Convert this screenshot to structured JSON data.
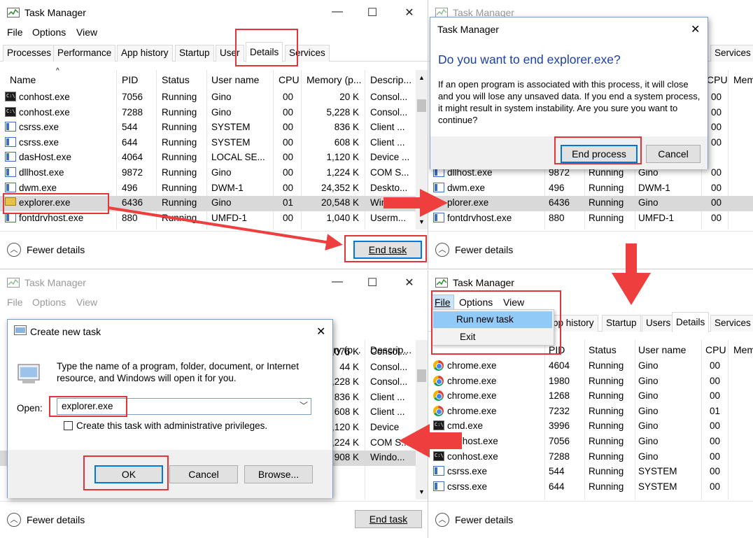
{
  "app": {
    "title": "Task Manager",
    "min": "—",
    "max": "☐",
    "close": "✕"
  },
  "menu": {
    "file": "File",
    "options": "Options",
    "view": "View",
    "run_new_task": "Run new task",
    "exit": "Exit"
  },
  "tabs": {
    "processes": "Processes",
    "performance": "Performance",
    "app_history": "App history",
    "pp_history": "pp history",
    "startup": "Startup",
    "users": "Users",
    "users_cut": "User",
    "details": "Details",
    "services": "Services"
  },
  "columns": {
    "name": "Name",
    "pid": "PID",
    "status": "Status",
    "user": "User name",
    "cpu": "CPU",
    "memory": "Memory (p...",
    "memory_cut": "ry (p...",
    "desc": "Descrip...",
    "mem_cut": "Mem"
  },
  "panel1_rows": [
    {
      "icon": "console",
      "name": "conhost.exe",
      "pid": "7056",
      "status": "Running",
      "user": "Gino",
      "cpu": "00",
      "mem": "20 K",
      "desc": "Consol..."
    },
    {
      "icon": "console",
      "name": "conhost.exe",
      "pid": "7288",
      "status": "Running",
      "user": "Gino",
      "cpu": "00",
      "mem": "5,228 K",
      "desc": "Consol..."
    },
    {
      "icon": "window",
      "name": "csrss.exe",
      "pid": "544",
      "status": "Running",
      "user": "SYSTEM",
      "cpu": "00",
      "mem": "836 K",
      "desc": "Client ..."
    },
    {
      "icon": "window",
      "name": "csrss.exe",
      "pid": "644",
      "status": "Running",
      "user": "SYSTEM",
      "cpu": "00",
      "mem": "608 K",
      "desc": "Client ..."
    },
    {
      "icon": "window",
      "name": "dasHost.exe",
      "pid": "4064",
      "status": "Running",
      "user": "LOCAL SE...",
      "cpu": "00",
      "mem": "1,120 K",
      "desc": "Device ..."
    },
    {
      "icon": "window",
      "name": "dllhost.exe",
      "pid": "9872",
      "status": "Running",
      "user": "Gino",
      "cpu": "00",
      "mem": "1,224 K",
      "desc": "COM S..."
    },
    {
      "icon": "window",
      "name": "dwm.exe",
      "pid": "496",
      "status": "Running",
      "user": "DWM-1",
      "cpu": "00",
      "mem": "24,352 K",
      "desc": "Deskto..."
    },
    {
      "icon": "folder",
      "name": "explorer.exe",
      "pid": "6436",
      "status": "Running",
      "user": "Gino",
      "cpu": "01",
      "mem": "20,548 K",
      "desc": "Win"
    },
    {
      "icon": "window",
      "name": "fontdrvhost.exe",
      "pid": "880",
      "status": "Running",
      "user": "UMFD-1",
      "cpu": "00",
      "mem": "1,040 K",
      "desc": "Userm..."
    }
  ],
  "panel2_rows": [
    {
      "name": "dllhost.exe",
      "pid": "9872",
      "status": "Running",
      "user": "Gino",
      "cpu": "00"
    },
    {
      "name": "dwm.exe",
      "pid": "496",
      "status": "Running",
      "user": "DWM-1",
      "cpu": "00"
    },
    {
      "name": "plorer.exe",
      "pid": "6436",
      "status": "Running",
      "user": "Gino",
      "cpu": "00"
    },
    {
      "name": "fontdrvhost.exe",
      "pid": "880",
      "status": "Running",
      "user": "UMFD-1",
      "cpu": "00"
    }
  ],
  "panel2_cpu_top": [
    "00",
    "00",
    "00",
    "00"
  ],
  "panel3_rows": [
    {
      "mem": ",076 K",
      "desc": "Consol..."
    },
    {
      "mem": "44 K",
      "desc": "Consol..."
    },
    {
      "mem": "5,228 K",
      "desc": "Consol..."
    },
    {
      "mem": "836 K",
      "desc": "Client ..."
    },
    {
      "mem": "608 K",
      "desc": "Client ..."
    },
    {
      "mem": ",120 K",
      "desc": "Device"
    },
    {
      "mem": ",224 K",
      "desc": "COM S..."
    },
    {
      "mem": "908 K",
      "desc": "Windo..."
    }
  ],
  "panel4_rows": [
    {
      "icon": "chrome",
      "name": "chrome.exe",
      "pid": "4604",
      "status": "Running",
      "user": "Gino",
      "cpu": "00"
    },
    {
      "icon": "chrome",
      "name": "chrome.exe",
      "pid": "1980",
      "status": "Running",
      "user": "Gino",
      "cpu": "00"
    },
    {
      "icon": "chrome",
      "name": "chrome.exe",
      "pid": "1268",
      "status": "Running",
      "user": "Gino",
      "cpu": "00"
    },
    {
      "icon": "chrome",
      "name": "chrome.exe",
      "pid": "7232",
      "status": "Running",
      "user": "Gino",
      "cpu": "01"
    },
    {
      "icon": "console",
      "name": "cmd.exe",
      "pid": "3996",
      "status": "Running",
      "user": "Gino",
      "cpu": "00"
    },
    {
      "icon": "console",
      "name": "conhost.exe",
      "pid": "7056",
      "status": "Running",
      "user": "Gino",
      "cpu": "00"
    },
    {
      "icon": "console",
      "name": "conhost.exe",
      "pid": "7288",
      "status": "Running",
      "user": "Gino",
      "cpu": "00"
    },
    {
      "icon": "window",
      "name": "csrss.exe",
      "pid": "544",
      "status": "Running",
      "user": "SYSTEM",
      "cpu": "00"
    },
    {
      "icon": "window",
      "name": "csrss.exe",
      "pid": "644",
      "status": "Running",
      "user": "SYSTEM",
      "cpu": "00"
    }
  ],
  "footer": {
    "fewer_details": "Fewer details",
    "end_task": "End task"
  },
  "end_dialog": {
    "title": "Task Manager",
    "heading": "Do you want to end explorer.exe?",
    "body": "If an open program is associated with this process, it will close and you will lose any unsaved data. If you end a system process, it might result in system instability. Are you sure you want to continue?",
    "end_process": "End process",
    "cancel": "Cancel"
  },
  "run_dialog": {
    "title": "Create new task",
    "desc": "Type the name of a program, folder, document, or Internet resource, and Windows will open it for you.",
    "open_label": "Open:",
    "value": "explorer.exe",
    "admin": "Create this task with administrative privileges.",
    "ok": "OK",
    "cancel": "Cancel",
    "browse": "Browse..."
  },
  "colors": {
    "highlight": "#e3343a",
    "selection": "#d9d9d9",
    "accent": "#0078d7",
    "menu_hover": "#91c9f7"
  }
}
